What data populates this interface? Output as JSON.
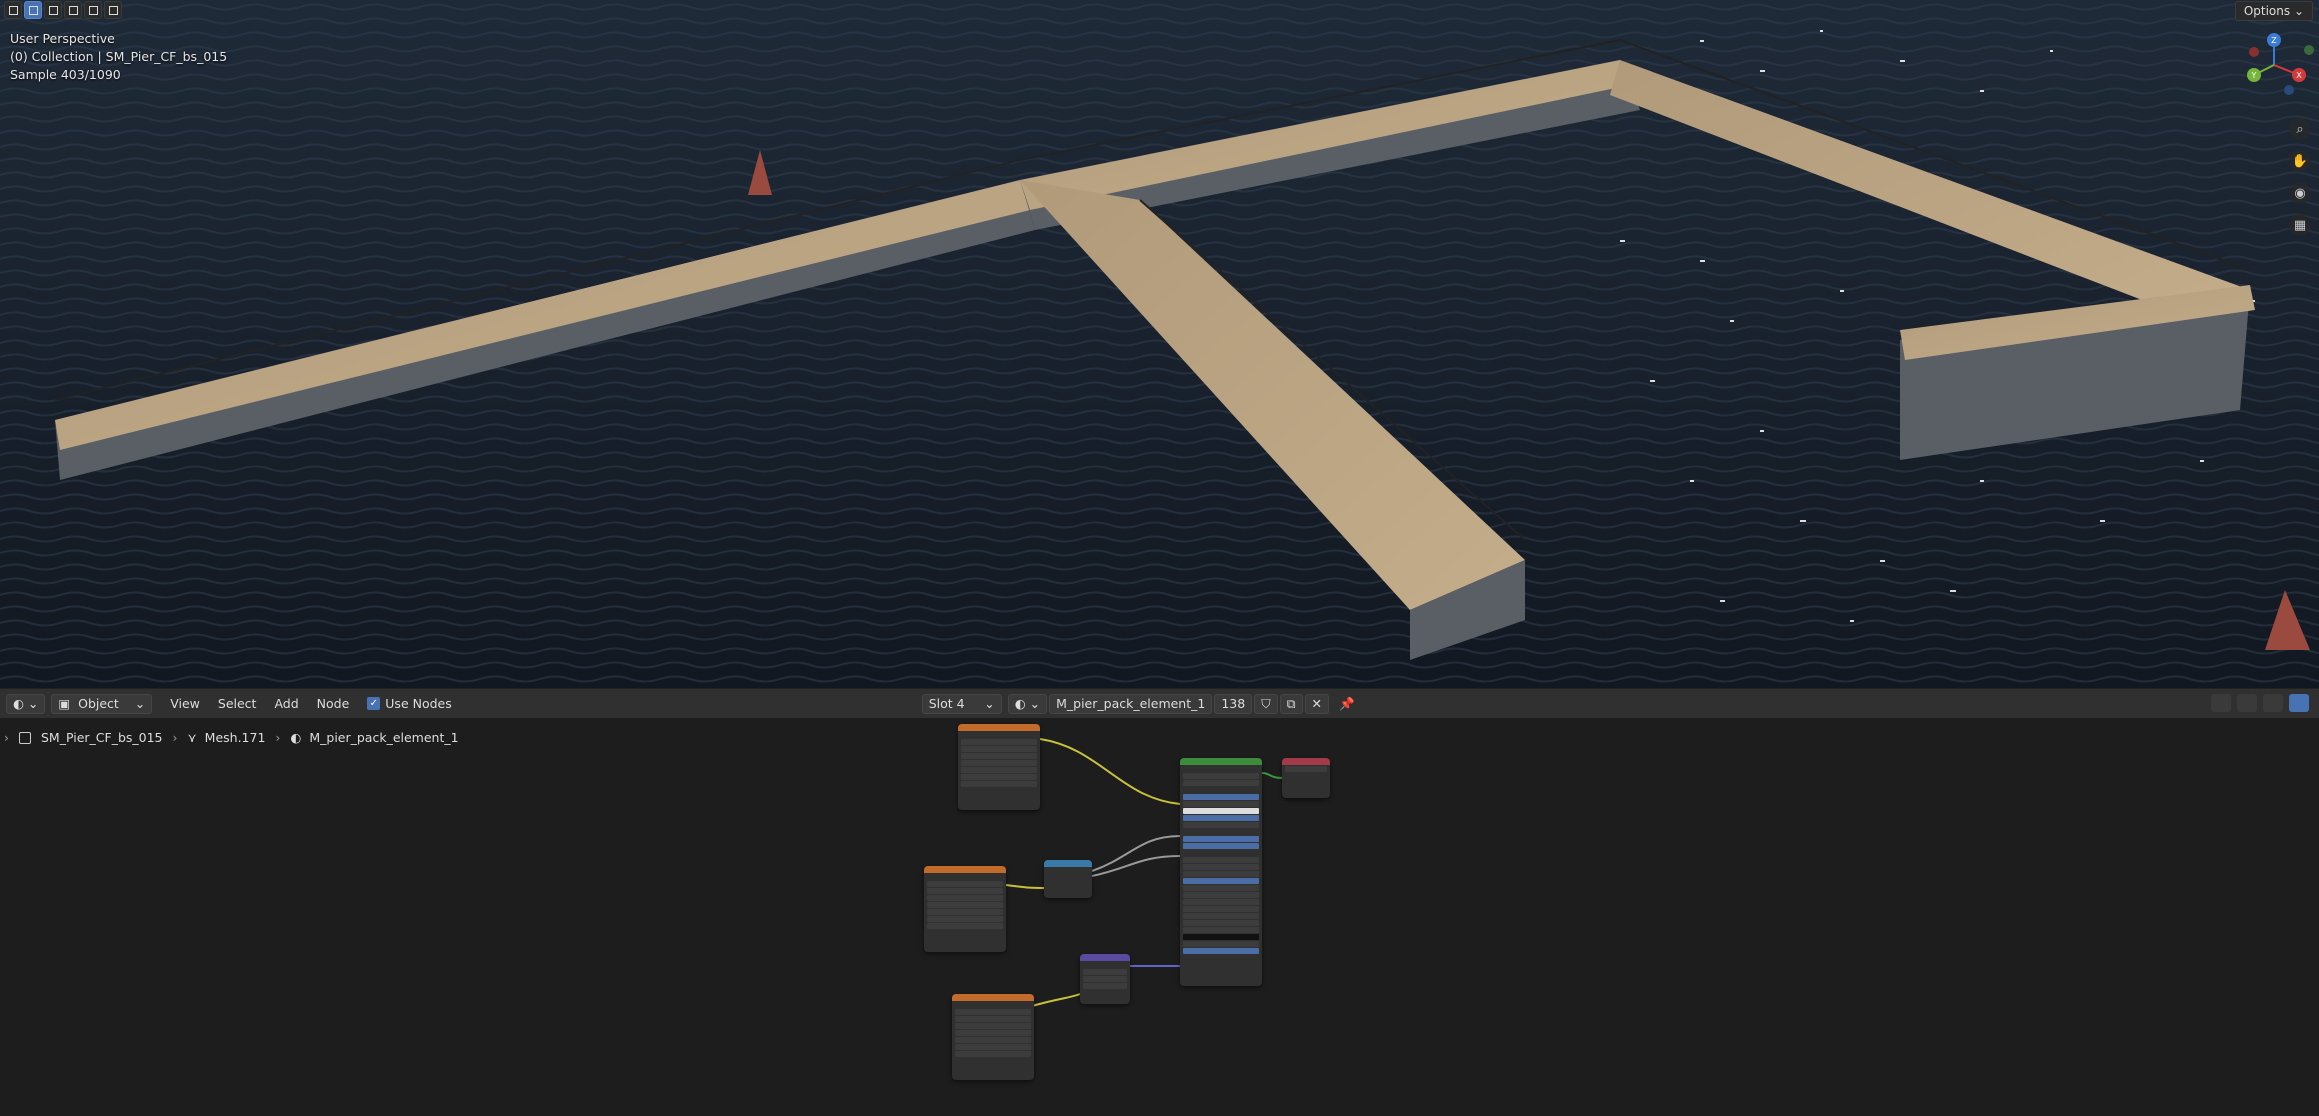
{
  "viewport": {
    "info_lines": [
      "User Perspective",
      "(0) Collection | SM_Pier_CF_bs_015",
      "Sample 403/1090"
    ],
    "options_label": "Options",
    "gizmo_axes": [
      "Z",
      "Y",
      "X"
    ]
  },
  "node_header": {
    "mode_label": "Object",
    "menus": [
      "View",
      "Select",
      "Add",
      "Node"
    ],
    "use_nodes_label": "Use Nodes",
    "slot_label": "Slot 4",
    "material_name": "M_pier_pack_element_1",
    "user_count": "138"
  },
  "breadcrumb": {
    "object": "SM_Pier_CF_bs_015",
    "mesh": "Mesh.171",
    "material": "M_pier_pack_element_1"
  },
  "colors": {
    "texture_node_header": "#c36b2a",
    "shader_node_header": "#3c8c3c",
    "vector_node_header": "#5a4aa0",
    "converter_node_header": "#3a7aa6",
    "output_node_header": "#a33a4a",
    "accent": "#4772b3"
  }
}
